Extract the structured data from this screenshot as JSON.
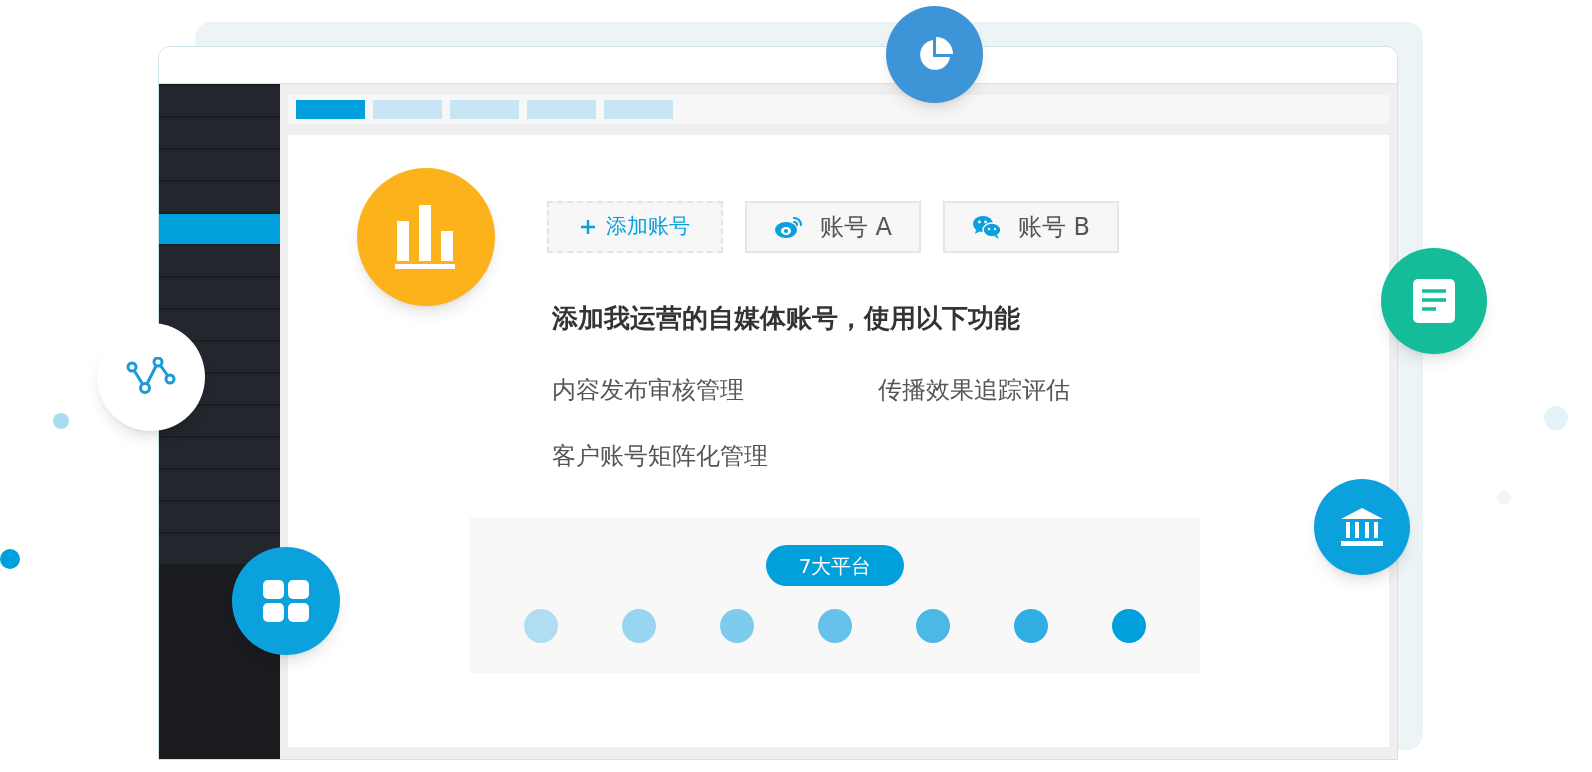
{
  "top_tabs": [
    {
      "selected": true
    },
    {
      "selected": false
    },
    {
      "selected": false
    },
    {
      "selected": false
    },
    {
      "selected": false
    }
  ],
  "sidebar": {
    "items": [
      {
        "selected": false
      },
      {
        "selected": false
      },
      {
        "selected": false
      },
      {
        "selected": false
      },
      {
        "selected": true
      },
      {
        "selected": false
      },
      {
        "selected": false
      },
      {
        "selected": false
      },
      {
        "selected": false
      },
      {
        "selected": false
      },
      {
        "selected": false
      },
      {
        "selected": false
      },
      {
        "selected": false
      },
      {
        "selected": false
      },
      {
        "selected": false
      }
    ]
  },
  "accounts": [
    {
      "kind": "add",
      "label": "添加账号"
    },
    {
      "kind": "weibo",
      "label": "账号 A"
    },
    {
      "kind": "wechat",
      "label": "账号 B"
    }
  ],
  "headline": "添加我运营的自媒体账号，使用以下功能",
  "features": [
    "内容发布审核管理",
    "传播效果追踪评估",
    "客户账号矩阵化管理"
  ],
  "platforms": {
    "badge": "7大平台",
    "dots": [
      {
        "color": "#b0ddf2"
      },
      {
        "color": "#97d5f0"
      },
      {
        "color": "#7fcbee"
      },
      {
        "color": "#66c2ea"
      },
      {
        "color": "#4bb8e6"
      },
      {
        "color": "#30ade3"
      },
      {
        "color": "#00a0dd"
      }
    ]
  }
}
